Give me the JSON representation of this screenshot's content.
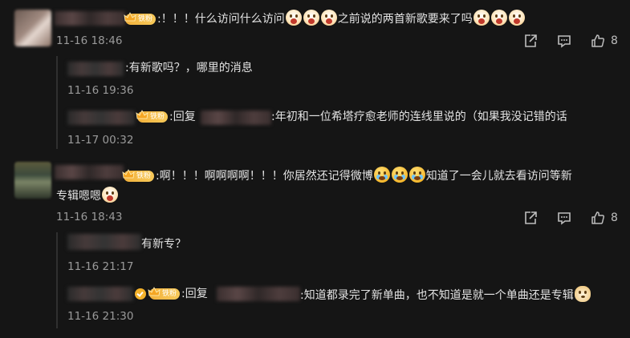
{
  "badge_label": "铁粉",
  "comments": [
    {
      "text_a": ":！！！什么访问什么访问",
      "text_b": "之前说的两首新歌要来了吗",
      "time": "11-16 18:46",
      "likes": "8",
      "replies": [
        {
          "text": ":有新歌吗？，哪里的消息",
          "time": "11-16 19:36"
        },
        {
          "reply_label": ":回复",
          "text": ":年初和一位希塔疗愈老师的连线里说的（如果我没记错的话",
          "time": "11-17 00:32"
        }
      ]
    },
    {
      "text_a": ":啊！！！啊啊啊啊！！！你居然还记得微博",
      "text_b": "知道了一会儿就去看访问等新",
      "text_c": "专辑嗯嗯",
      "time": "11-16 18:43",
      "likes": "8",
      "replies": [
        {
          "text": "有新专？",
          "time": "11-16 21:17"
        },
        {
          "reply_label": ":回复",
          "text": ":知道都录完了新单曲，也不知道是就一个单曲还是专辑",
          "time": "11-16 21:30"
        }
      ]
    }
  ],
  "icons": [
    "share-icon",
    "comment-icon",
    "like-icon",
    "fan-crown-icon",
    "verified-icon"
  ]
}
